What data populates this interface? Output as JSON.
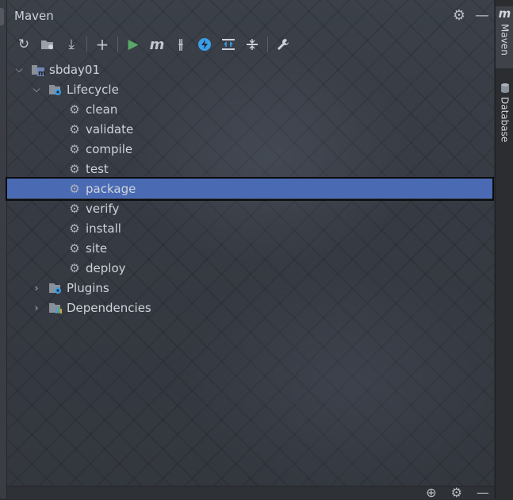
{
  "panel": {
    "title": "Maven",
    "settings_icon": "gear-icon",
    "minimize_icon": "minimize-icon"
  },
  "toolbar": [
    {
      "name": "reload-all-projects-button",
      "icon": "↻"
    },
    {
      "name": "generate-sources-button",
      "icon": "⛁"
    },
    {
      "name": "download-sources-button",
      "icon": "⤓"
    },
    {
      "name": "add-maven-project-button",
      "icon": "+"
    },
    {
      "name": "run-maven-build-button",
      "icon": "▶"
    },
    {
      "name": "execute-maven-goal-button",
      "icon": "m"
    },
    {
      "name": "toggle-offline-mode-button",
      "icon": "⫲"
    },
    {
      "name": "skip-tests-button",
      "icon": "ϟ"
    },
    {
      "name": "show-dependencies-button",
      "icon": "⇈"
    },
    {
      "name": "collapse-all-button",
      "icon": "⇳"
    },
    {
      "name": "maven-settings-button",
      "icon": "🔧"
    }
  ],
  "tree": {
    "project": "sbday01",
    "lifecycle_label": "Lifecycle",
    "lifecycle_goals": [
      "clean",
      "validate",
      "compile",
      "test",
      "package",
      "verify",
      "install",
      "site",
      "deploy"
    ],
    "selected_goal": "package",
    "plugins_label": "Plugins",
    "dependencies_label": "Dependencies"
  },
  "right_strip": {
    "maven_tab": "Maven",
    "database_tab": "Database"
  },
  "colors": {
    "selection": "#4a6ab4",
    "run_green": "#59a869",
    "accent_blue": "#3c9ee8"
  }
}
